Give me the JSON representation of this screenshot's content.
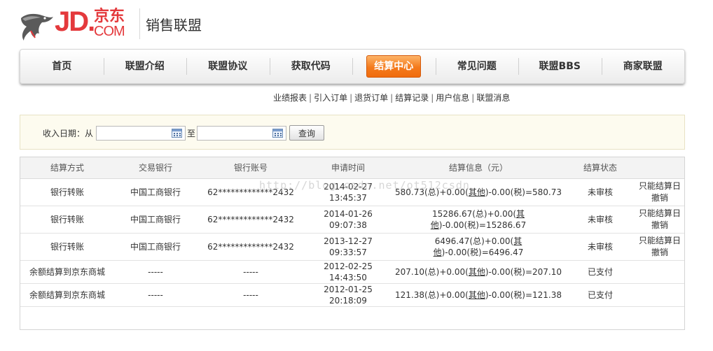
{
  "brand": {
    "logo_jd": "JD.",
    "logo_cn": "京东",
    "logo_com": "COM",
    "site_title": "销售联盟"
  },
  "nav": {
    "items": [
      {
        "label": "首页"
      },
      {
        "label": "联盟介绍"
      },
      {
        "label": "联盟协议"
      },
      {
        "label": "获取代码"
      },
      {
        "label": "结算中心"
      },
      {
        "label": "常见问题"
      },
      {
        "label": "联盟BBS"
      },
      {
        "label": "商家联盟"
      }
    ],
    "active_index": 4
  },
  "subnav": {
    "items": [
      "业绩报表",
      "引入订单",
      "退货订单",
      "结算记录",
      "用户信息",
      "联盟消息"
    ],
    "separator": "|"
  },
  "filter": {
    "label": "收入日期：从",
    "to_label": "至",
    "from_value": "",
    "to_value": "",
    "query_label": "查询"
  },
  "table": {
    "headers": [
      "结算方式",
      "交易银行",
      "银行账号",
      "申请时间",
      "结算信息（元）",
      "结算状态",
      ""
    ],
    "rows": [
      {
        "method": "银行转账",
        "bank": "中国工商银行",
        "account": "62*************2432",
        "time": "2014-02-27 13:45:37",
        "info_pre": "580.73(总)+0.00(",
        "info_link": "其他",
        "info_post": ")-0.00(税)=580.73",
        "status": "未审核",
        "note": "只能结算日撤销"
      },
      {
        "method": "银行转账",
        "bank": "中国工商银行",
        "account": "62*************2432",
        "time": "2014-01-26 09:07:38",
        "info_pre": "15286.67(总)+0.00(",
        "info_link": "其他",
        "info_post": ")-0.00(税)=15286.67",
        "status": "未审核",
        "note": "只能结算日撤销"
      },
      {
        "method": "银行转账",
        "bank": "中国工商银行",
        "account": "62*************2432",
        "time": "2013-12-27 09:33:57",
        "info_pre": "6496.47(总)+0.00(",
        "info_link": "其他",
        "info_post": ")-0.00(税)=6496.47",
        "status": "未审核",
        "note": "只能结算日撤销"
      },
      {
        "method": "余额结算到京东商城",
        "bank": "-----",
        "account": "-----",
        "time": "2012-02-25 14:43:50",
        "info_pre": "207.10(总)+0.00(",
        "info_link": "其他",
        "info_post": ")-0.00(税)=207.10",
        "status": "已支付",
        "note": ""
      },
      {
        "method": "余额结算到京东商城",
        "bank": "-----",
        "account": "-----",
        "time": "2012-01-25 20:18:09",
        "info_pre": "121.38(总)+0.00(",
        "info_link": "其他",
        "info_post": ")-0.00(税)=121.38",
        "status": "已支付",
        "note": ""
      }
    ]
  },
  "watermark": "http://blog.csdn.net/ot512csdn"
}
